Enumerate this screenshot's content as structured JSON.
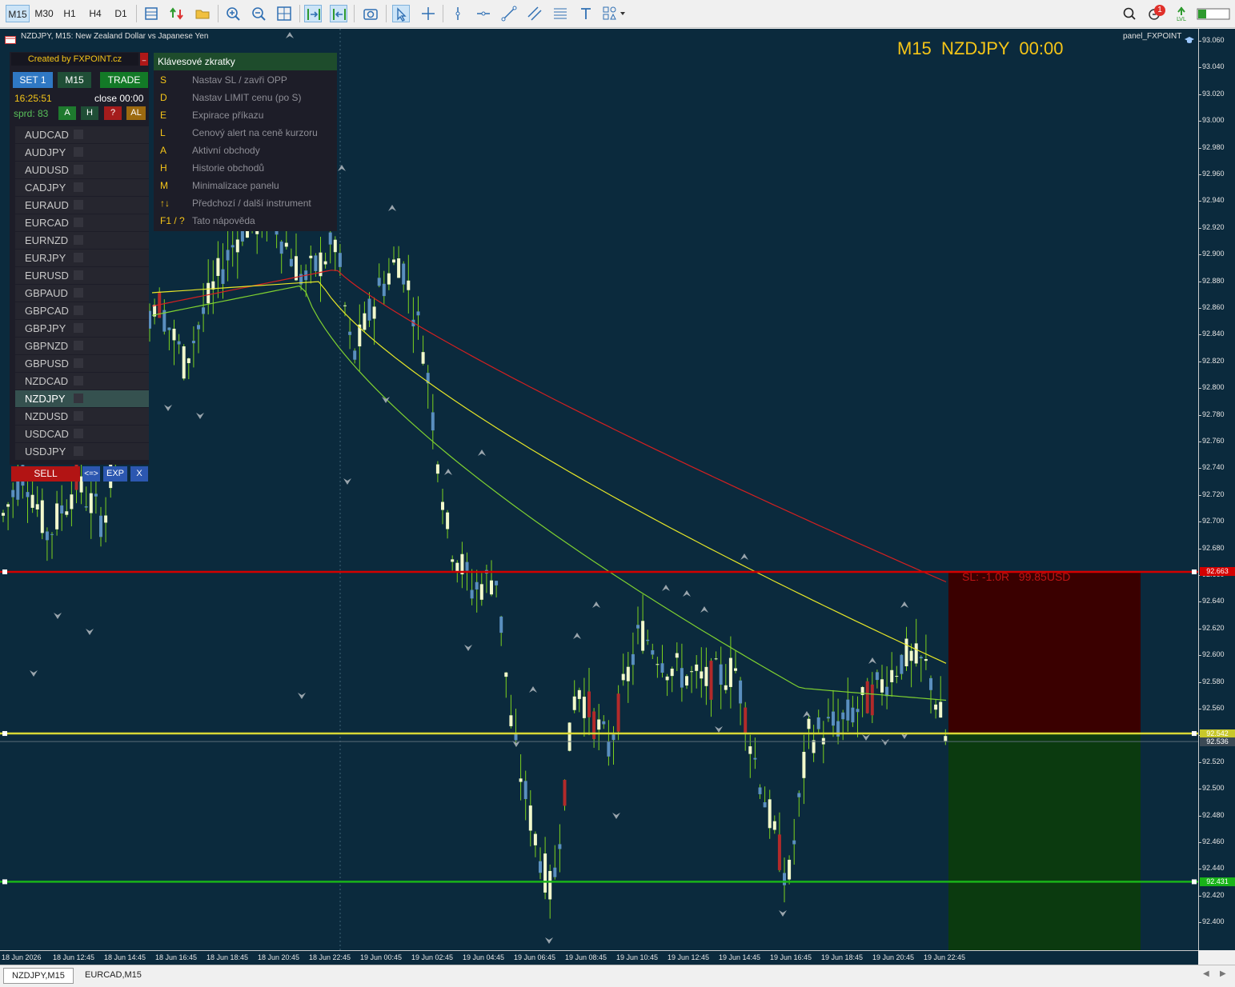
{
  "toolbar": {
    "timeframes": [
      "M15",
      "M30",
      "H1",
      "H4",
      "D1"
    ],
    "active_timeframe": "M15",
    "icons": [
      "chart-bars-icon",
      "trade-arrows-icon",
      "open-folder-icon",
      "zoom-in-icon",
      "zoom-out-icon",
      "grid-icon",
      "autoscroll-icon",
      "chart-shift-icon",
      "screenshot-icon",
      "cursor-icon",
      "crosshair-icon",
      "vertical-line-icon",
      "horizontal-line-icon",
      "trend-line-icon",
      "equidistant-channel-icon",
      "fibonacci-icon",
      "text-icon",
      "shapes-icon"
    ],
    "notification_count": "1",
    "right_icons": [
      "search-icon",
      "notifications-icon",
      "signal-icon",
      "app-window-icon"
    ]
  },
  "chart": {
    "title": "NZDJPY, M15:  New Zealand Dollar vs Japanese Yen",
    "header": "M15  NZDJPY  00:00",
    "panel_label": "panel_FXPOINT",
    "sl_label": "SL: -1.0R   99.85USD",
    "background": "#0b2a3d"
  },
  "panel": {
    "created_by": "Created by FXPOINT.cz",
    "buttons": {
      "set": "SET 1",
      "timeframe": "M15",
      "trade": "TRADE"
    },
    "time": "16:25:51",
    "close": "close 00:00",
    "spread": "sprd: 83",
    "small_buttons": [
      "A",
      "H",
      "?",
      "AL"
    ],
    "symbols": [
      "AUDCAD",
      "AUDJPY",
      "AUDUSD",
      "CADJPY",
      "EURAUD",
      "EURCAD",
      "EURNZD",
      "EURJPY",
      "EURUSD",
      "GBPAUD",
      "GBPCAD",
      "GBPJPY",
      "GBPNZD",
      "GBPUSD",
      "NZDCAD",
      "NZDJPY",
      "NZDUSD",
      "USDCAD",
      "USDJPY"
    ],
    "active_symbol": "NZDJPY",
    "bottom_buttons": {
      "sell": "SELL",
      "swap": "<=>",
      "exp": "EXP",
      "close": "X"
    }
  },
  "help": {
    "title": "Klávesové zkratky",
    "items": [
      {
        "key": "S",
        "desc": "Nastav SL / zavři OPP"
      },
      {
        "key": "D",
        "desc": "Nastav LIMIT cenu (po S)"
      },
      {
        "key": "E",
        "desc": "Expirace příkazu"
      },
      {
        "key": "L",
        "desc": "Cenový alert na ceně kurzoru"
      },
      {
        "key": "A",
        "desc": "Aktivní obchody"
      },
      {
        "key": "H",
        "desc": "Historie obchodů"
      },
      {
        "key": "M",
        "desc": "Minimalizace panelu"
      },
      {
        "key": "↑↓",
        "desc": "Předchozí / další instrument"
      },
      {
        "key": "F1 / ?",
        "desc": "Tato nápověda"
      }
    ]
  },
  "price_scale": {
    "ticks": [
      "93.060",
      "93.040",
      "93.020",
      "93.000",
      "92.980",
      "92.960",
      "92.940",
      "92.920",
      "92.900",
      "92.880",
      "92.860",
      "92.840",
      "92.820",
      "92.800",
      "92.780",
      "92.760",
      "92.740",
      "92.720",
      "92.700",
      "92.680",
      "92.660",
      "92.640",
      "92.620",
      "92.600",
      "92.580",
      "92.560",
      "92.540",
      "92.520",
      "92.500",
      "92.480",
      "92.460",
      "92.440",
      "92.420",
      "92.400"
    ],
    "sl_price": "92.663",
    "entry_price": "92.542",
    "bid_price": "92.536",
    "tp_price": "92.431"
  },
  "time_scale": {
    "ticks": [
      "18 Jun 2026",
      "18 Jun 12:45",
      "18 Jun 14:45",
      "18 Jun 16:45",
      "18 Jun 18:45",
      "18 Jun 20:45",
      "18 Jun 22:45",
      "19 Jun 00:45",
      "19 Jun 02:45",
      "19 Jun 04:45",
      "19 Jun 06:45",
      "19 Jun 08:45",
      "19 Jun 10:45",
      "19 Jun 12:45",
      "19 Jun 14:45",
      "19 Jun 16:45",
      "19 Jun 18:45",
      "19 Jun 20:45",
      "19 Jun 22:45"
    ]
  },
  "tabs": [
    "NZDJPY,M15",
    "EURCAD,M15"
  ],
  "active_tab": "NZDJPY,M15",
  "colors": {
    "sl_line": "#d40000",
    "entry_line": "#d8d836",
    "tp_line": "#19b319",
    "accent_yellow": "#f5c518",
    "bull_candle": "#f2f9cc",
    "bear_candle_long": "#b22a2a",
    "bear_candle_short": "#5a8fbf",
    "wick": "#7cd11e"
  }
}
